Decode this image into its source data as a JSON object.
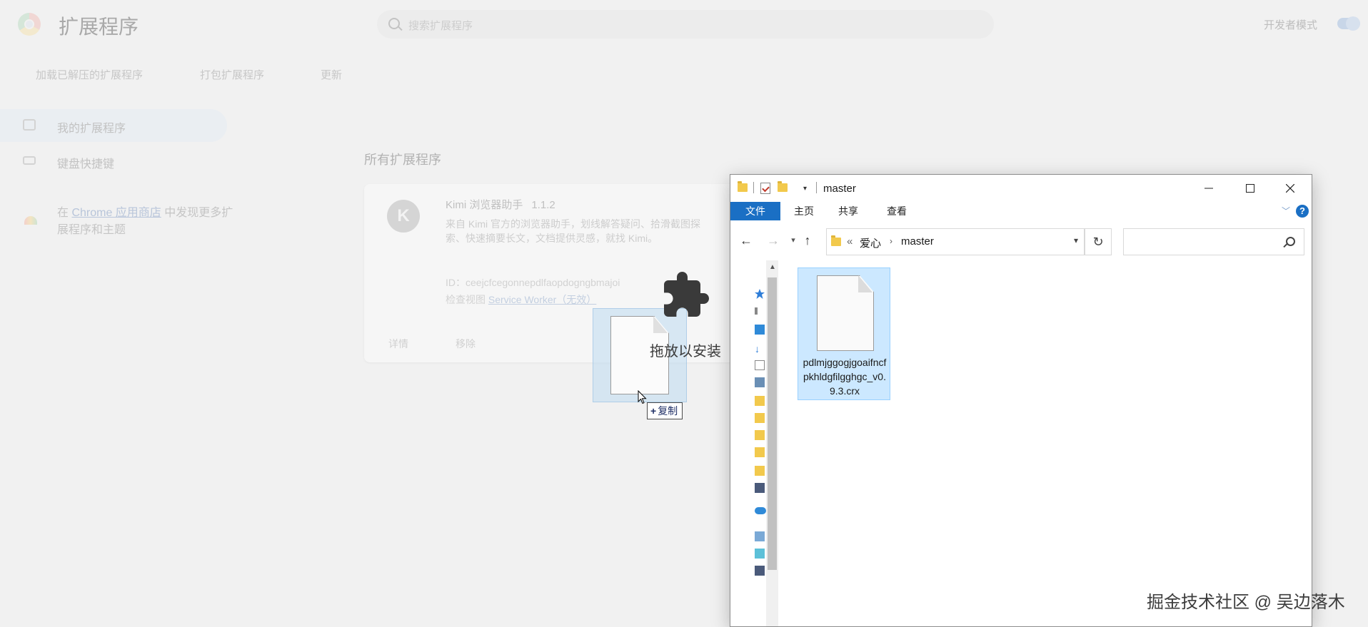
{
  "chrome": {
    "page_title": "扩展程序",
    "search_placeholder": "搜索扩展程序",
    "dev_mode_label": "开发者模式",
    "dev_mode_enabled": true,
    "toolbar": {
      "load_unpacked": "加载已解压的扩展程序",
      "pack": "打包扩展程序",
      "update": "更新"
    },
    "sidebar": {
      "items": [
        {
          "label": "我的扩展程序",
          "icon": "extension-icon",
          "active": true
        },
        {
          "label": "键盘快捷键",
          "icon": "keyboard-icon",
          "active": false
        }
      ],
      "store_prefix": "在 ",
      "store_link": "Chrome 应用商店",
      "store_suffix": " 中发现更多扩展程序和主题"
    },
    "section_title": "所有扩展程序",
    "extension": {
      "avatar_letter": "K",
      "name": "Kimi 浏览器助手",
      "version": "1.1.2",
      "description": "来自 Kimi 官方的浏览器助手，划线解答疑问、拾滑截图探索、快速摘要长文，文档提供灵感，就找 Kimi。",
      "id_line": "ID：ceejcfcegonnepdlfaopdogngbmajoi",
      "inspect_prefix": "检查视图 ",
      "inspect_link": "Service Worker（无效）",
      "details_btn": "详情",
      "remove_btn": "移除"
    }
  },
  "drag": {
    "drop_label": "拖放以安装",
    "copy_label": "复制",
    "copy_plus": "+"
  },
  "explorer": {
    "title": "master",
    "ribbon_tabs": [
      "文件",
      "主页",
      "共享",
      "查看"
    ],
    "help": "?",
    "address": {
      "overflow": "«",
      "crumbs": [
        "爱心",
        "master"
      ]
    },
    "search_placeholder": "",
    "file": {
      "name": "pdlmjggogjgoaifncfpkhldgfilgghgc_v0.9.3.crx",
      "selected": true
    }
  },
  "watermark": "掘金技术社区 @ 吴边落木",
  "colors": {
    "accent": "#1a6fc4",
    "selection": "#cce8ff",
    "page_bg": "#f1f1f1"
  }
}
